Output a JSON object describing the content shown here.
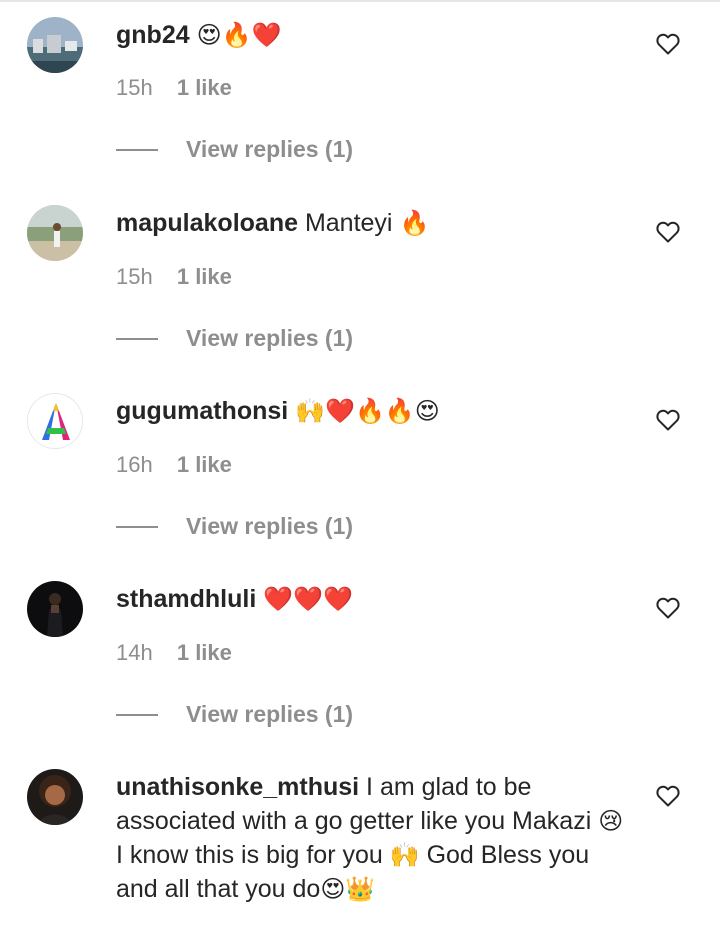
{
  "comments": [
    {
      "username": "gnb24",
      "text": "",
      "emoji": "😍🔥❤️",
      "time": "15h",
      "likes": "1 like",
      "replies": "View replies (1)",
      "avatar": "harbor-photo-avatar"
    },
    {
      "username": "mapulakoloane",
      "text": "Manteyi",
      "emoji": "🔥",
      "time": "15h",
      "likes": "1 like",
      "replies": "View replies (1)",
      "avatar": "garden-person-avatar"
    },
    {
      "username": "gugumathonsi",
      "text": "",
      "emoji": "🙌❤️🔥🔥😍",
      "time": "16h",
      "likes": "1 like",
      "replies": "View replies (1)",
      "avatar": "colorful-letter-a-avatar"
    },
    {
      "username": "sthamdhluli",
      "text": "",
      "emoji": "❤️❤️❤️",
      "time": "14h",
      "likes": "1 like",
      "replies": "View replies (1)",
      "avatar": "dark-portrait-avatar"
    },
    {
      "username": "unathisonke_mthusi",
      "text_parts": [
        "I am glad to be associated with a go getter like you Makazi ",
        "😢",
        " I know this is big for you ",
        "🙌",
        " God Bless you and all that you do",
        "😍👑"
      ],
      "avatar": "woman-portrait-avatar"
    }
  ],
  "colors": {
    "text": "#262626",
    "muted": "#8e8e8e",
    "divider": "#e6e6e6"
  },
  "icons": {
    "like": "heart-outline-icon"
  }
}
